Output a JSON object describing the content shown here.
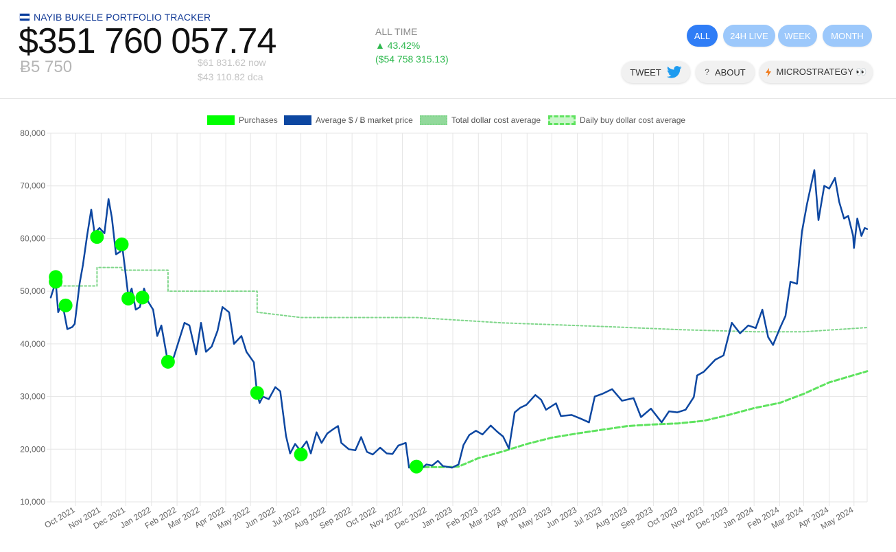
{
  "header": {
    "app_title": "NAYIB BUKELE PORTFOLIO TRACKER",
    "portfolio_value": "$351 760 057.74",
    "btc_amount": "Ƀ5 750",
    "price_now": "$61 831.62",
    "price_now_suffix": "now",
    "price_dca": "$43 110.82",
    "price_dca_suffix": "dca",
    "alltime_label": "ALL TIME",
    "alltime_pct": "▲ 43.42%",
    "alltime_usd": "($54 758 315.13)"
  },
  "range_buttons": [
    {
      "label": "ALL",
      "active": true
    },
    {
      "label": "24H LIVE",
      "active": false
    },
    {
      "label": "WEEK",
      "active": false
    },
    {
      "label": "MONTH",
      "active": false
    }
  ],
  "action_buttons": {
    "tweet": "TWEET",
    "about": "ABOUT",
    "microstrategy": "MICROSTRATEGY 👀"
  },
  "icons": {
    "flag": "el-salvador-flag-icon",
    "tweet": "twitter-bird-icon",
    "about": "question-mark-icon",
    "microstrategy": "lightning-icon"
  },
  "colors": {
    "price_line": "#0d47a1",
    "purchases": "#00ff00",
    "total_dca": "#7fd68a",
    "daily_dca": "#5fe35f",
    "active_button": "#2f7df6",
    "inactive_button": "#9cc8fb",
    "positive": "#2db84d"
  },
  "chart_data": {
    "type": "line",
    "legend": [
      "Purchases",
      "Average $ / Ƀ market price",
      "Total dollar cost average",
      "Daily buy dollar cost average"
    ],
    "legend_position": "top",
    "grid": true,
    "ylim": [
      10000,
      80000
    ],
    "y_ticks": [
      "10,000",
      "20,000",
      "30,000",
      "40,000",
      "50,000",
      "60,000",
      "70,000",
      "80,000"
    ],
    "x_ticks": [
      "Oct 2021",
      "Nov 2021",
      "Dec 2021",
      "Jan 2022",
      "Feb 2022",
      "Mar 2022",
      "Apr 2022",
      "May 2022",
      "Jun 2022",
      "Jul 2022",
      "Aug 2022",
      "Sep 2022",
      "Oct 2022",
      "Nov 2022",
      "Dec 2022",
      "Jan 2023",
      "Feb 2023",
      "Mar 2023",
      "Apr 2023",
      "May 2023",
      "Jun 2023",
      "Jul 2023",
      "Aug 2023",
      "Sep 2023",
      "Oct 2023",
      "Nov 2023",
      "Dec 2023",
      "Jan 2024",
      "Feb 2024",
      "Mar 2024",
      "Apr 2024",
      "May 2024"
    ],
    "x_range": [
      "2021-09-01",
      "2024-05-17"
    ],
    "series": [
      {
        "name": "Average $ / Ƀ market price",
        "style": "solid",
        "points": [
          [
            "2021-09-01",
            48800
          ],
          [
            "2021-09-07",
            51800
          ],
          [
            "2021-09-10",
            46000
          ],
          [
            "2021-09-15",
            47800
          ],
          [
            "2021-09-21",
            42800
          ],
          [
            "2021-09-27",
            43200
          ],
          [
            "2021-09-30",
            43800
          ],
          [
            "2021-10-06",
            51500
          ],
          [
            "2021-10-10",
            55000
          ],
          [
            "2021-10-15",
            60500
          ],
          [
            "2021-10-20",
            65500
          ],
          [
            "2021-10-24",
            61000
          ],
          [
            "2021-10-30",
            62000
          ],
          [
            "2021-11-05",
            61000
          ],
          [
            "2021-11-10",
            67500
          ],
          [
            "2021-11-14",
            64000
          ],
          [
            "2021-11-19",
            57000
          ],
          [
            "2021-11-24",
            57500
          ],
          [
            "2021-11-27",
            58000
          ],
          [
            "2021-12-04",
            49000
          ],
          [
            "2021-12-08",
            50500
          ],
          [
            "2021-12-13",
            46500
          ],
          [
            "2021-12-18",
            47000
          ],
          [
            "2021-12-23",
            50500
          ],
          [
            "2021-12-28",
            48000
          ],
          [
            "2022-01-03",
            46500
          ],
          [
            "2022-01-08",
            41500
          ],
          [
            "2022-01-13",
            43500
          ],
          [
            "2022-01-22",
            35500
          ],
          [
            "2022-01-28",
            37500
          ],
          [
            "2022-02-06",
            42000
          ],
          [
            "2022-02-10",
            44000
          ],
          [
            "2022-02-16",
            43500
          ],
          [
            "2022-02-24",
            38000
          ],
          [
            "2022-03-02",
            44000
          ],
          [
            "2022-03-08",
            38500
          ],
          [
            "2022-03-15",
            39500
          ],
          [
            "2022-03-22",
            42500
          ],
          [
            "2022-03-28",
            47000
          ],
          [
            "2022-04-05",
            46000
          ],
          [
            "2022-04-11",
            40000
          ],
          [
            "2022-04-20",
            41500
          ],
          [
            "2022-04-26",
            38500
          ],
          [
            "2022-05-05",
            36500
          ],
          [
            "2022-05-09",
            30500
          ],
          [
            "2022-05-12",
            28800
          ],
          [
            "2022-05-16",
            30000
          ],
          [
            "2022-05-23",
            29500
          ],
          [
            "2022-05-31",
            31800
          ],
          [
            "2022-06-06",
            31000
          ],
          [
            "2022-06-13",
            22500
          ],
          [
            "2022-06-18",
            19200
          ],
          [
            "2022-06-24",
            21000
          ],
          [
            "2022-06-30",
            19800
          ],
          [
            "2022-07-08",
            21500
          ],
          [
            "2022-07-13",
            19200
          ],
          [
            "2022-07-20",
            23200
          ],
          [
            "2022-07-26",
            21200
          ],
          [
            "2022-08-02",
            23000
          ],
          [
            "2022-08-10",
            23900
          ],
          [
            "2022-08-15",
            24400
          ],
          [
            "2022-08-19",
            21200
          ],
          [
            "2022-08-28",
            20000
          ],
          [
            "2022-09-05",
            19800
          ],
          [
            "2022-09-12",
            22300
          ],
          [
            "2022-09-19",
            19500
          ],
          [
            "2022-09-26",
            19000
          ],
          [
            "2022-10-05",
            20300
          ],
          [
            "2022-10-13",
            19200
          ],
          [
            "2022-10-20",
            19100
          ],
          [
            "2022-10-27",
            20700
          ],
          [
            "2022-11-05",
            21200
          ],
          [
            "2022-11-09",
            16500
          ],
          [
            "2022-11-15",
            16800
          ],
          [
            "2022-11-21",
            15900
          ],
          [
            "2022-11-30",
            17100
          ],
          [
            "2022-12-07",
            16900
          ],
          [
            "2022-12-14",
            17800
          ],
          [
            "2022-12-20",
            16800
          ],
          [
            "2022-12-31",
            16500
          ],
          [
            "2023-01-08",
            17100
          ],
          [
            "2023-01-14",
            20800
          ],
          [
            "2023-01-21",
            22700
          ],
          [
            "2023-01-29",
            23500
          ],
          [
            "2023-02-06",
            22800
          ],
          [
            "2023-02-16",
            24500
          ],
          [
            "2023-02-24",
            23300
          ],
          [
            "2023-03-03",
            22400
          ],
          [
            "2023-03-10",
            20100
          ],
          [
            "2023-03-17",
            27000
          ],
          [
            "2023-03-24",
            27900
          ],
          [
            "2023-03-31",
            28400
          ],
          [
            "2023-04-11",
            30300
          ],
          [
            "2023-04-18",
            29400
          ],
          [
            "2023-04-24",
            27500
          ],
          [
            "2023-05-06",
            28700
          ],
          [
            "2023-05-12",
            26300
          ],
          [
            "2023-05-25",
            26500
          ],
          [
            "2023-06-05",
            25800
          ],
          [
            "2023-06-15",
            25100
          ],
          [
            "2023-06-22",
            30000
          ],
          [
            "2023-07-01",
            30500
          ],
          [
            "2023-07-13",
            31400
          ],
          [
            "2023-07-25",
            29200
          ],
          [
            "2023-08-08",
            29700
          ],
          [
            "2023-08-17",
            26100
          ],
          [
            "2023-08-29",
            27700
          ],
          [
            "2023-09-11",
            25100
          ],
          [
            "2023-09-20",
            27200
          ],
          [
            "2023-09-30",
            27000
          ],
          [
            "2023-10-10",
            27500
          ],
          [
            "2023-10-20",
            29900
          ],
          [
            "2023-10-24",
            34000
          ],
          [
            "2023-11-01",
            34700
          ],
          [
            "2023-11-15",
            37000
          ],
          [
            "2023-11-25",
            37800
          ],
          [
            "2023-12-05",
            44000
          ],
          [
            "2023-12-15",
            42000
          ],
          [
            "2023-12-25",
            43500
          ],
          [
            "2024-01-03",
            43000
          ],
          [
            "2024-01-11",
            46500
          ],
          [
            "2024-01-18",
            41300
          ],
          [
            "2024-01-24",
            39800
          ],
          [
            "2024-02-01",
            42900
          ],
          [
            "2024-02-08",
            45300
          ],
          [
            "2024-02-14",
            51800
          ],
          [
            "2024-02-22",
            51400
          ],
          [
            "2024-02-28",
            61300
          ],
          [
            "2024-03-05",
            66500
          ],
          [
            "2024-03-14",
            73000
          ],
          [
            "2024-03-19",
            63500
          ],
          [
            "2024-03-26",
            70000
          ],
          [
            "2024-04-01",
            69500
          ],
          [
            "2024-04-08",
            71500
          ],
          [
            "2024-04-13",
            67000
          ],
          [
            "2024-04-19",
            63800
          ],
          [
            "2024-04-24",
            64300
          ],
          [
            "2024-04-30",
            60500
          ],
          [
            "2024-05-01",
            58200
          ],
          [
            "2024-05-05",
            63800
          ],
          [
            "2024-05-10",
            60500
          ],
          [
            "2024-05-14",
            62000
          ],
          [
            "2024-05-17",
            61800
          ]
        ]
      },
      {
        "name": "Total dollar cost average",
        "style": "dotted",
        "points": [
          [
            "2021-09-07",
            51000
          ],
          [
            "2021-10-27",
            51000
          ],
          [
            "2021-10-27",
            54500
          ],
          [
            "2021-11-26",
            54500
          ],
          [
            "2021-11-26",
            54000
          ],
          [
            "2022-01-21",
            54000
          ],
          [
            "2022-01-21",
            50000
          ],
          [
            "2022-05-09",
            50000
          ],
          [
            "2022-05-09",
            46000
          ],
          [
            "2022-07-01",
            45000
          ],
          [
            "2022-11-18",
            45000
          ],
          [
            "2023-03-01",
            44000
          ],
          [
            "2023-07-01",
            43300
          ],
          [
            "2023-10-01",
            42700
          ],
          [
            "2024-01-01",
            42300
          ],
          [
            "2024-03-01",
            42300
          ],
          [
            "2024-05-17",
            43100
          ]
        ]
      },
      {
        "name": "Daily buy dollar cost average",
        "style": "dashed",
        "points": [
          [
            "2022-11-18",
            16600
          ],
          [
            "2022-12-20",
            16600
          ],
          [
            "2023-01-08",
            16700
          ],
          [
            "2023-02-01",
            18300
          ],
          [
            "2023-03-01",
            19500
          ],
          [
            "2023-04-01",
            21000
          ],
          [
            "2023-05-01",
            22200
          ],
          [
            "2023-06-01",
            23000
          ],
          [
            "2023-07-01",
            23700
          ],
          [
            "2023-08-01",
            24400
          ],
          [
            "2023-09-01",
            24700
          ],
          [
            "2023-10-01",
            24900
          ],
          [
            "2023-11-01",
            25400
          ],
          [
            "2023-12-01",
            26500
          ],
          [
            "2024-01-01",
            27800
          ],
          [
            "2024-02-01",
            28800
          ],
          [
            "2024-03-01",
            30500
          ],
          [
            "2024-04-01",
            32700
          ],
          [
            "2024-05-17",
            34800
          ]
        ]
      }
    ],
    "purchases": [
      [
        "2021-09-07",
        51800
      ],
      [
        "2021-09-07",
        52700
      ],
      [
        "2021-09-19",
        47300
      ],
      [
        "2021-10-27",
        60300
      ],
      [
        "2021-11-26",
        58900
      ],
      [
        "2021-12-04",
        48600
      ],
      [
        "2021-12-21",
        48800
      ],
      [
        "2022-01-21",
        36600
      ],
      [
        "2022-05-09",
        30700
      ],
      [
        "2022-07-01",
        19000
      ],
      [
        "2022-11-18",
        16700
      ]
    ]
  }
}
